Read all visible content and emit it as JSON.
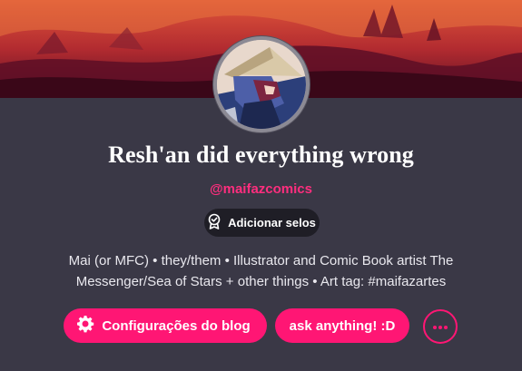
{
  "header": {
    "banner": "banner-image",
    "avatar": "avatar-image"
  },
  "profile": {
    "title": "Resh'an did everything wrong",
    "handle": "@maifazcomics",
    "badge_label": "Adicionar selos",
    "bio": "Mai (or MFC) • they/them • Illustrator and Comic Book artist The Messenger/Sea of Stars + other things • Art tag: #maifazartes"
  },
  "actions": {
    "config_label": "Configurações do blog",
    "ask_label": "ask anything! :D",
    "more_icon": "more-icon"
  },
  "colors": {
    "background": "#3a3846",
    "accent": "#ff1674",
    "handle": "#ff2e7e",
    "badge_bg": "#1f1e26"
  }
}
